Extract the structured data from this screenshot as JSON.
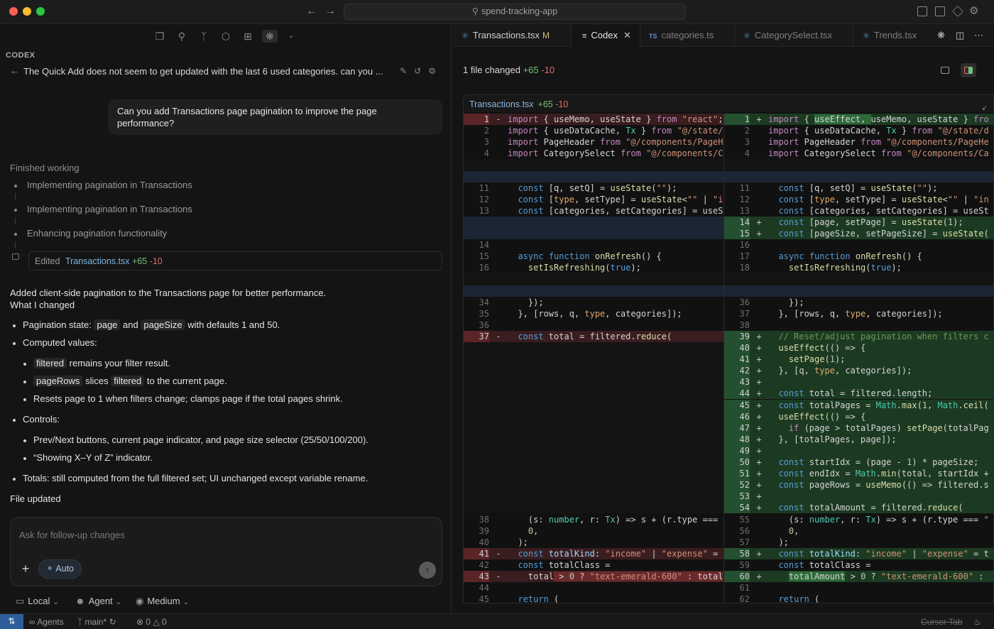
{
  "window": {
    "search_text": "spend-tracking-app",
    "colors": {
      "bg": "#141414",
      "accent": "#2d5d9a",
      "add": "#74c07a",
      "del": "#e06c6c"
    }
  },
  "left_toolbar": {
    "icons": [
      "copy-icon",
      "search-icon",
      "branch-icon",
      "cube-icon",
      "grid-icon",
      "openai-icon",
      "chevron-down-icon"
    ]
  },
  "codex": {
    "section_label": "CODEX",
    "thread_title": "The Quick Add does not seem to get updated with the last 6 used categories. can you ...",
    "user_message": "Can you add Transactions page pagination to improve the page performance?",
    "finished_label": "Finished working",
    "steps": [
      "Implementing pagination in Transactions",
      "Implementing pagination in Transactions",
      "Enhancing pagination functionality"
    ],
    "edited": {
      "prefix": "Edited",
      "file": "Transactions.tsx",
      "added": "+65",
      "removed": "-10"
    },
    "summary_line1": "Added client-side pagination to the Transactions page for better performance.",
    "summary_line2": "What I changed",
    "bullets": {
      "b1_pre": "Pagination state:",
      "b1_code1": "page",
      "b1_mid": "and",
      "b1_code2": "pageSize",
      "b1_post": "with defaults 1 and 50.",
      "b2": "Computed values:",
      "b2a_code": "filtered",
      "b2a_post": "remains your filter result.",
      "b2b_code1": "pageRows",
      "b2b_mid": "slices",
      "b2b_code2": "filtered",
      "b2b_post": "to the current page.",
      "b2c": "Resets page to 1 when filters change; clamps page if the total pages shrink.",
      "b3": "Controls:",
      "b3a": "Prev/Next buttons, current page indicator, and page size selector (25/50/100/200).",
      "b3b": "“Showing X–Y of Z” indicator.",
      "b4": "Totals: still computed from the full filtered set; UI unchanged except variable rename."
    },
    "file_updated_label": "File updated",
    "input_placeholder": "Ask for follow-up changes",
    "auto_label": "Auto",
    "options": {
      "local": "Local",
      "agent": "Agent",
      "medium": "Medium"
    }
  },
  "tabs": [
    {
      "label": "Transactions.tsx",
      "badge": "M"
    },
    {
      "label": "Codex"
    },
    {
      "label": "categories.ts",
      "badge": "TS"
    },
    {
      "label": "CategorySelect.tsx"
    },
    {
      "label": "Trends.tsx"
    }
  ],
  "diff": {
    "files_changed": "1 file changed",
    "added": "+65",
    "removed": "-10",
    "file": "Transactions.tsx"
  },
  "statusbar": {
    "agents": "Agents",
    "branch": "main*",
    "errors": "0",
    "warnings": "0",
    "cursor_tab": "Cursor Tab"
  }
}
